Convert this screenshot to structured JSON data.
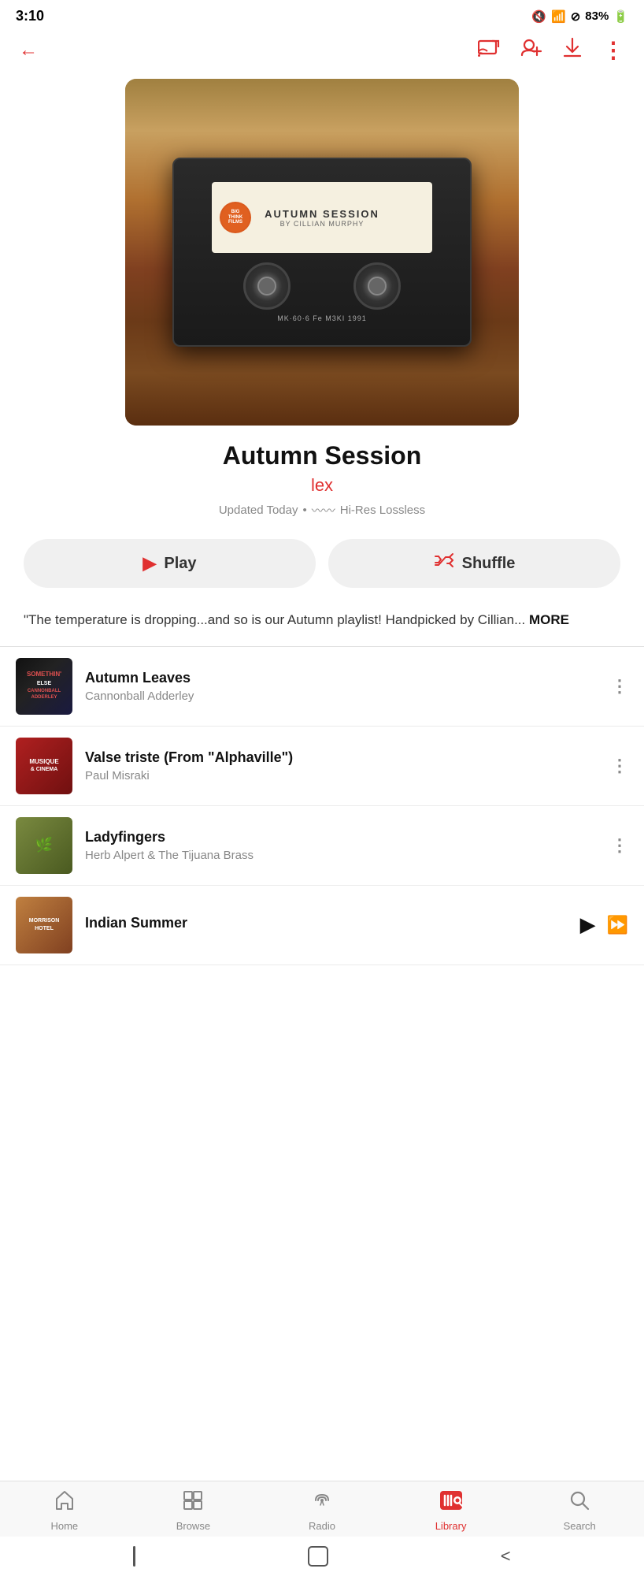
{
  "status": {
    "time": "3:10",
    "battery": "83%",
    "signal": "●"
  },
  "header": {
    "back_label": "←",
    "cast_label": "⬜",
    "add_user_label": "👤+",
    "download_label": "↓",
    "more_label": "⋮"
  },
  "playlist": {
    "title": "Autumn Session",
    "author": "lex",
    "meta": "Updated Today  •  Hi-Res Lossless",
    "description": "\"The temperature is dropping...and so is our Autumn playlist! Handpicked by Cillian...",
    "more_label": "MORE"
  },
  "buttons": {
    "play_label": "Play",
    "shuffle_label": "Shuffle"
  },
  "tracks": [
    {
      "title": "Autumn Leaves",
      "artist": "Cannonball Adderley",
      "art_label": "SOMETHIN' ELSE\nCANNONBALL\nADDERLEY",
      "playing": false
    },
    {
      "title": "Valse triste (From \"Alphaville\")",
      "artist": "Paul Misraki",
      "art_label": "MUSIQUE\n& CINEMA",
      "playing": false
    },
    {
      "title": "Ladyfingers",
      "artist": "Herb Alpert & The Tijuana Brass",
      "art_label": "",
      "playing": false
    },
    {
      "title": "Indian Summer",
      "artist": "",
      "art_label": "MORRISON\nHOTEL",
      "playing": true
    }
  ],
  "nav": {
    "items": [
      {
        "label": "Home",
        "icon": "🏠",
        "active": false
      },
      {
        "label": "Browse",
        "icon": "⊞",
        "active": false
      },
      {
        "label": "Radio",
        "icon": "((·))",
        "active": false
      },
      {
        "label": "Library",
        "icon": "🎵",
        "active": true
      },
      {
        "label": "Search",
        "icon": "🔍",
        "active": false
      }
    ]
  },
  "cassette": {
    "title": "AUTUMN SESSION",
    "subtitle": "BY CILLIAN MURPHY",
    "model": "MK·60·6  Fe  M3KI  1991"
  }
}
